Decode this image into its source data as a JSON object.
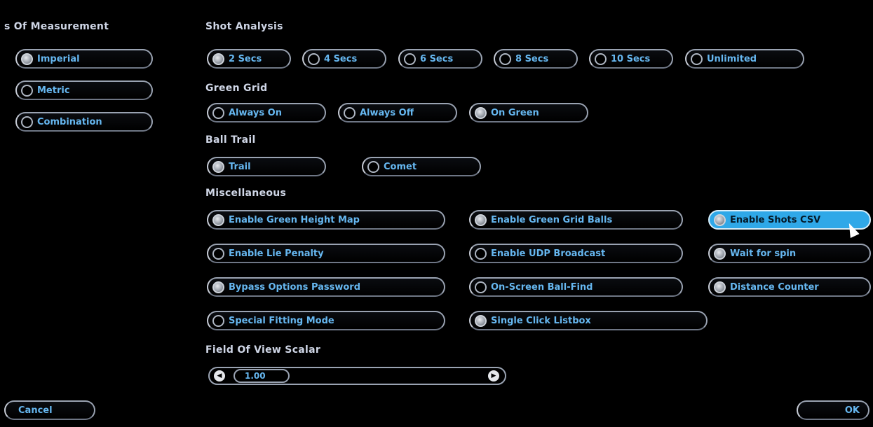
{
  "units": {
    "heading": "s Of Measurement",
    "options": [
      {
        "label": "Imperial",
        "selected": true
      },
      {
        "label": "Metric",
        "selected": false
      },
      {
        "label": "Combination",
        "selected": false
      }
    ]
  },
  "shot_analysis": {
    "heading": "Shot Analysis",
    "options": [
      {
        "label": "2 Secs",
        "selected": true
      },
      {
        "label": "4 Secs",
        "selected": false
      },
      {
        "label": "6 Secs",
        "selected": false
      },
      {
        "label": "8 Secs",
        "selected": false
      },
      {
        "label": "10 Secs",
        "selected": false
      },
      {
        "label": "Unlimited",
        "selected": false
      }
    ]
  },
  "green_grid": {
    "heading": "Green Grid",
    "options": [
      {
        "label": "Always On",
        "selected": false
      },
      {
        "label": "Always Off",
        "selected": false
      },
      {
        "label": "On Green",
        "selected": true
      }
    ]
  },
  "ball_trail": {
    "heading": "Ball Trail",
    "options": [
      {
        "label": "Trail",
        "selected": true
      },
      {
        "label": "Comet",
        "selected": false
      }
    ]
  },
  "misc": {
    "heading": "Miscellaneous",
    "options": [
      {
        "label": "Enable Green Height Map",
        "checked": true
      },
      {
        "label": "Enable Green Grid Balls",
        "checked": true
      },
      {
        "label": "Enable Shots CSV",
        "checked": true,
        "highlighted": true
      },
      {
        "label": "Enable Lie Penalty",
        "checked": false
      },
      {
        "label": "Enable UDP Broadcast",
        "checked": false
      },
      {
        "label": "Wait for spin",
        "checked": true
      },
      {
        "label": "Bypass Options Password",
        "checked": true
      },
      {
        "label": "On-Screen Ball-Find",
        "checked": false
      },
      {
        "label": "Distance Counter",
        "checked": true
      },
      {
        "label": "Special Fitting Mode",
        "checked": false
      },
      {
        "label": "Single Click Listbox",
        "checked": true
      }
    ]
  },
  "fov": {
    "heading": "Field Of View Scalar",
    "value": "1.00",
    "left_glyph": "◀",
    "right_glyph": "▶"
  },
  "footer": {
    "cancel_label": "Cancel",
    "ok_label": "OK"
  },
  "colors": {
    "accent": "#2fa8e8",
    "text_blue": "#66b7f0"
  }
}
